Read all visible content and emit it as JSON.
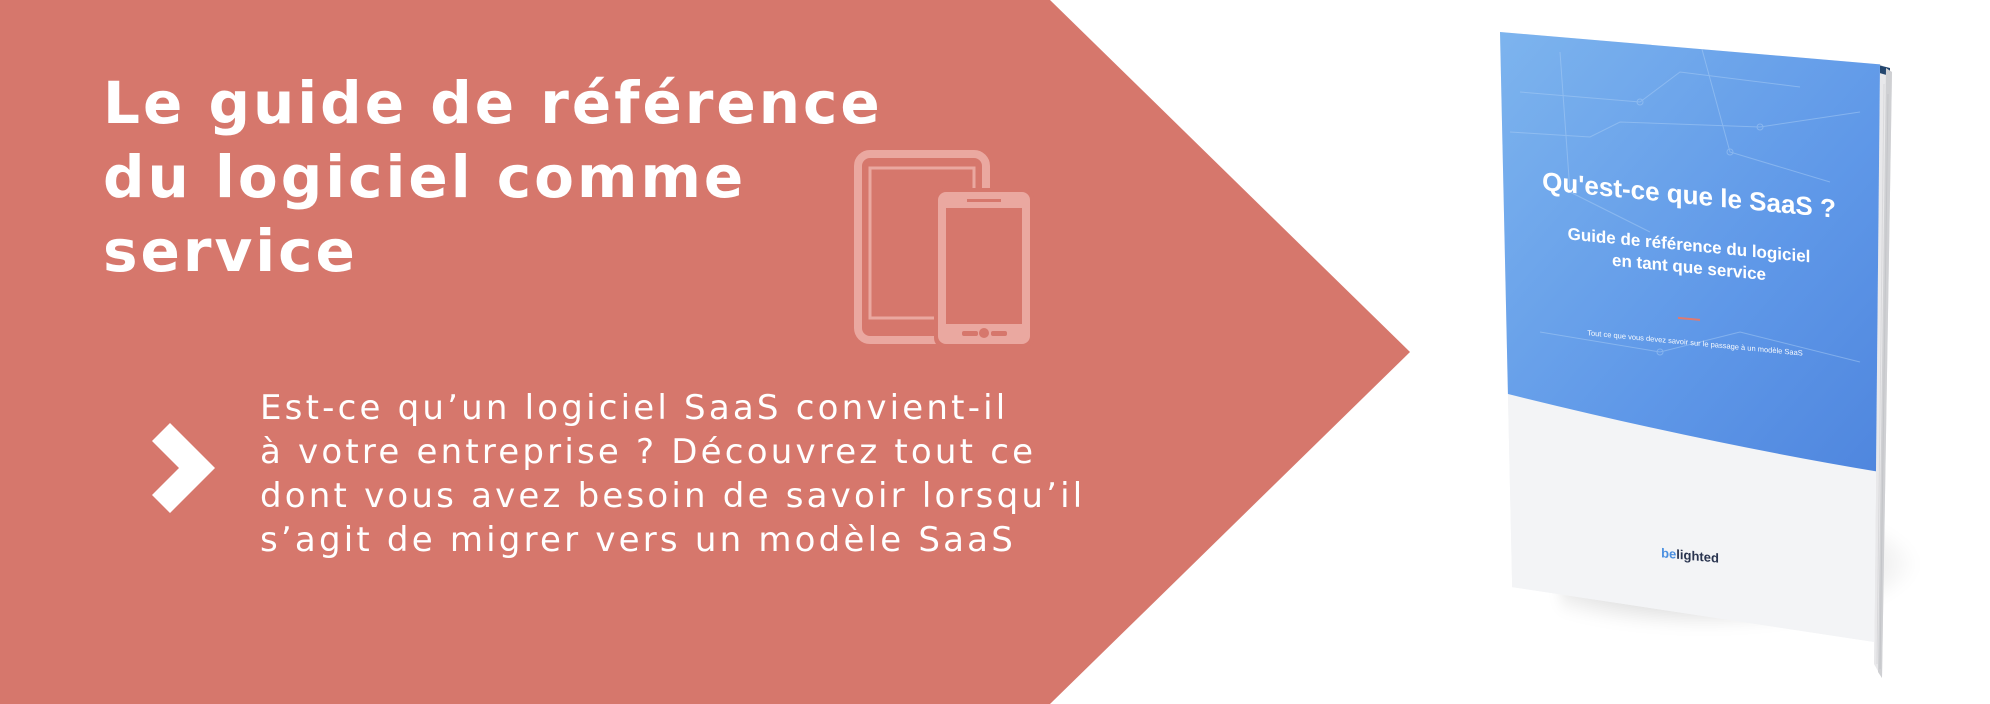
{
  "colors": {
    "accent": "#d6776c",
    "book_blue": "#5b9ce8",
    "book_spine": "#24466e",
    "text_light": "#ffffff"
  },
  "banner": {
    "headline_lines": [
      "Le guide de référence",
      "du logiciel comme",
      "service"
    ],
    "description_lines": [
      "Est-ce qu’un logiciel SaaS convient-il",
      "à votre entreprise ? Découvrez tout ce",
      "dont vous avez besoin de savoir lorsqu’il",
      "s’agit de migrer vers un modèle SaaS"
    ],
    "icons": [
      "devices-icon",
      "chevron-right-icon"
    ]
  },
  "book": {
    "title": "Qu'est-ce que le SaaS ?",
    "subtitle_lines": [
      "Guide de référence du logiciel",
      "en tant que service"
    ],
    "tagline": "Tout ce que vous devez savoir sur le passage à un modèle SaaS",
    "logo_part1": "be",
    "logo_part2": "lighted"
  }
}
